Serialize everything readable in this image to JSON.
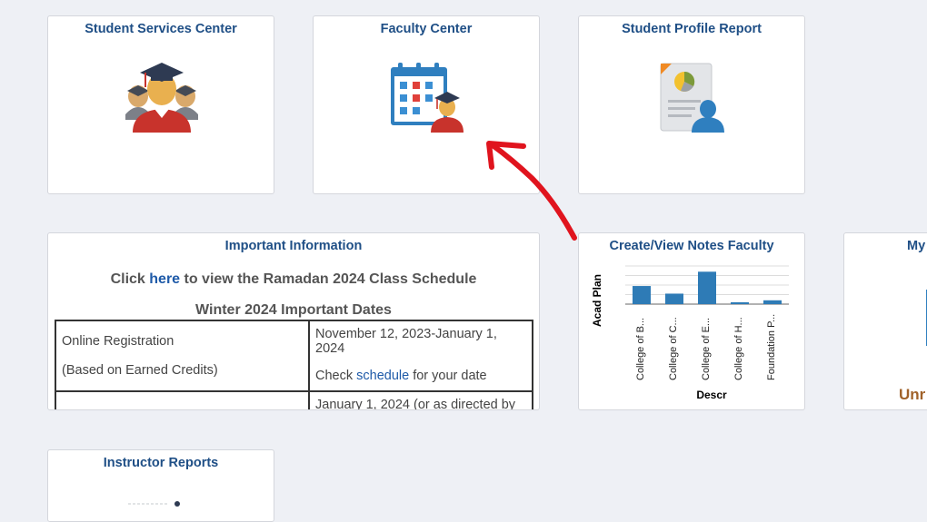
{
  "tiles": {
    "student_services": {
      "title": "Student Services Center",
      "icon": "graduates-icon"
    },
    "faculty_center": {
      "title": "Faculty Center",
      "icon": "calendar-graduate-icon"
    },
    "student_profile": {
      "title": "Student Profile Report",
      "icon": "report-profile-icon"
    },
    "important_info": {
      "title": "Important Information",
      "line1_before": "Click ",
      "line1_link": "here",
      "line1_after": " to view the Ramadan 2024 Class Schedule",
      "line2": "Winter 2024 Important Dates",
      "rows": [
        {
          "label1": "Online Registration",
          "label2": "(Based on Earned Credits)",
          "value1": "November 12, 2023-January 1, 2024",
          "value2_before": "Check ",
          "value2_link": "schedule",
          "value2_after": " for your date"
        },
        {
          "label1": "",
          "value1": "January 1, 2024 (or as directed by"
        }
      ]
    },
    "notes_faculty": {
      "title": "Create/View Notes Faculty"
    },
    "my_partial": {
      "title": "My",
      "footer": "Unr"
    },
    "instructor_reports": {
      "title": "Instructor Reports"
    }
  },
  "chart_data": {
    "type": "bar",
    "categories": [
      "College of B...",
      "College of C...",
      "College of E...",
      "College of H...",
      "Foundation P..."
    ],
    "values": [
      19,
      11,
      34,
      2,
      4
    ],
    "ylabel": "Acad Plan",
    "xlabel": "Descr",
    "ylim": [
      0,
      40
    ],
    "color": "#2e7bb6",
    "grid": true
  },
  "annotation": {
    "color": "#e0141e"
  }
}
